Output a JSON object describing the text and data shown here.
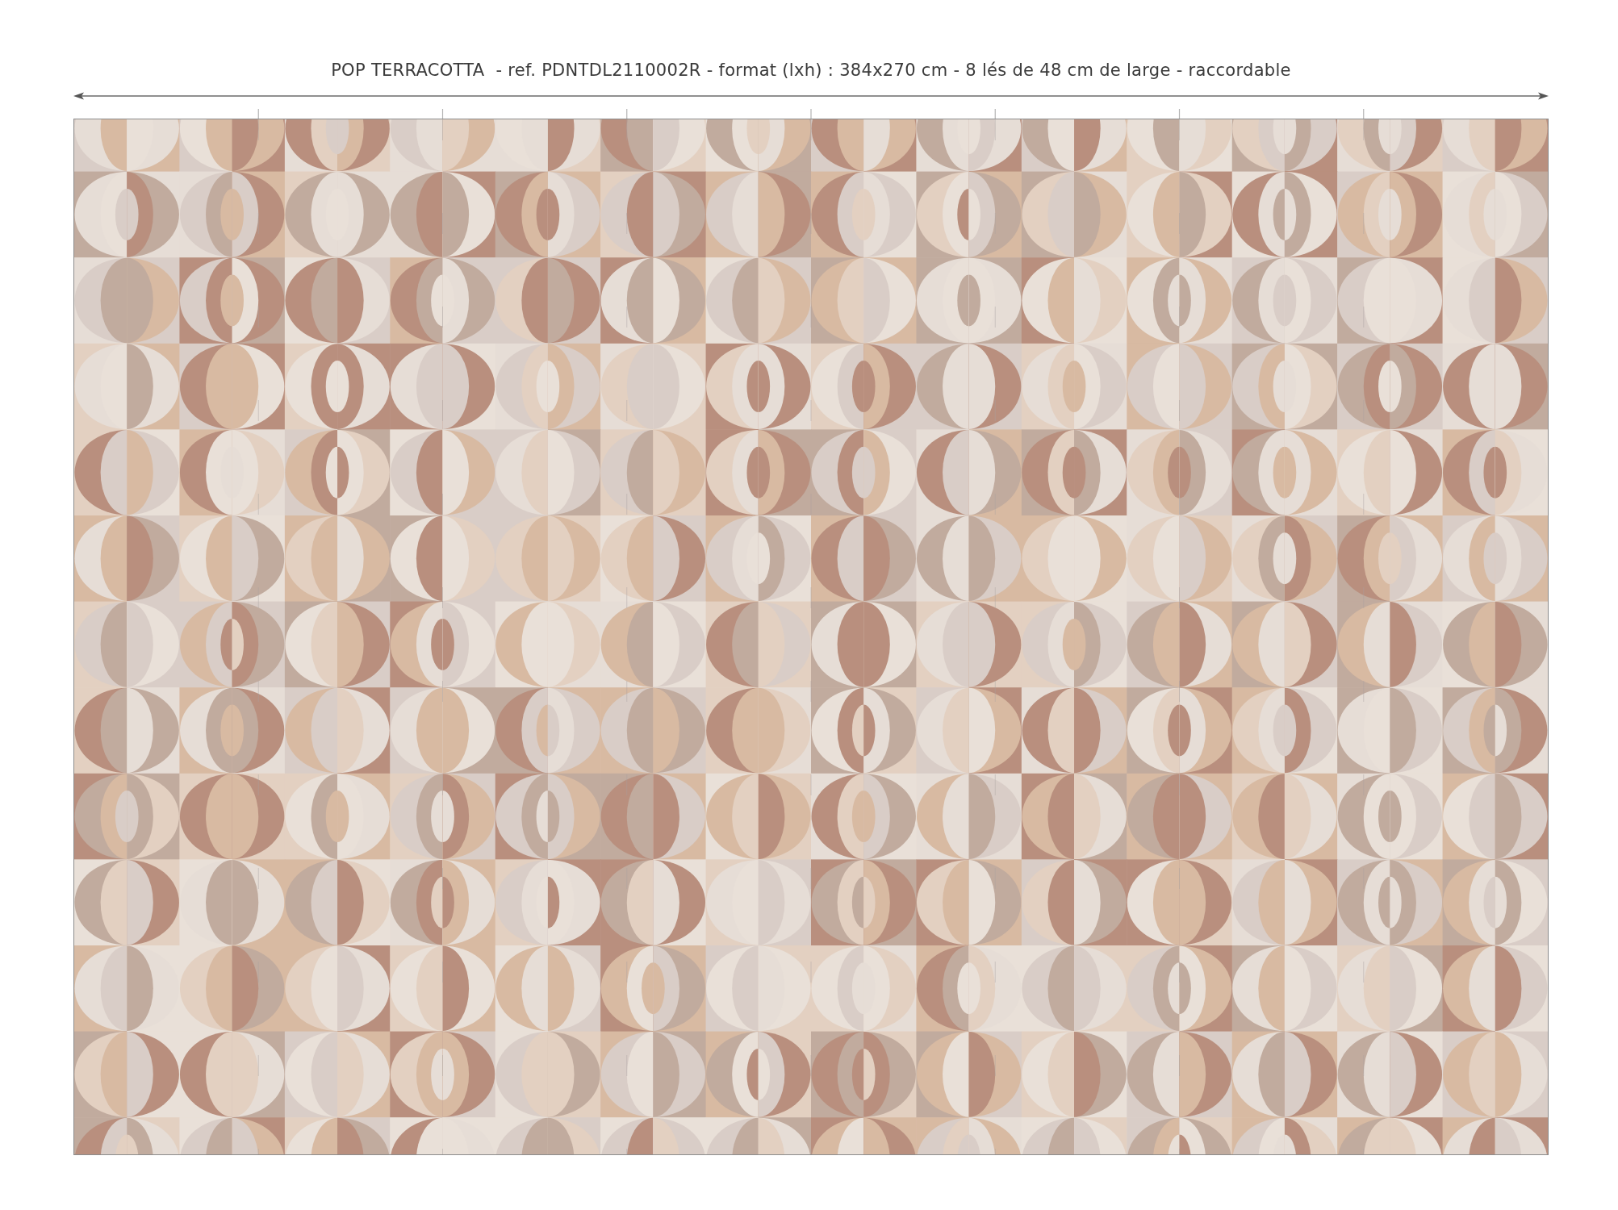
{
  "caption": {
    "text": "POP TERRACOTTA  - ref. PDNTDL2110002R - format (lxh) : 384x270 cm - 8 lés de 48 cm de large - raccordable"
  }
}
